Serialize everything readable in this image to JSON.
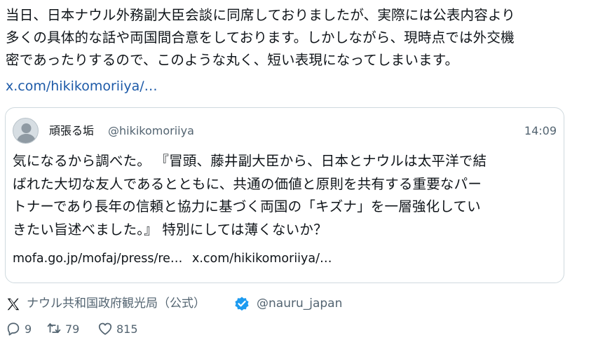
{
  "post": {
    "text_lines": [
      "当日、日本ナウル外務副大臣会談に同席しておりましたが、実際には公表内容より",
      "多くの具体的な話や両国間合意をしております。しかしながら、現時点では外交機",
      "密であったりするので、このような丸く、短い表現になってしまいます。"
    ],
    "link": "x.com/hikikomoriiya/…"
  },
  "quote": {
    "author_name": "頑張る垢",
    "author_handle": "@hikikomoriiya",
    "time": "14:09",
    "text_lines": [
      "気になるから調べた。 『冒頭、藤井副大臣から、日本とナウルは太平洋で結",
      "ばれた大切な友人であるとともに、共通の価値と原則を共有する重要なパー",
      "トナーであり長年の信頼と協力に基づく両国の「キズナ」を一層強化してい",
      "きたい旨述べました。』 特別にしては薄くないか？"
    ],
    "link_1": "mofa.go.jp/mofaj/press/re…",
    "link_2": "x.com/hikikomoriiya/…"
  },
  "author": {
    "name": "ナウル共和国政府観光局（公式）",
    "handle": "@nauru_japan",
    "verified_color": "#1d9bf0",
    "platform_icon": "x-logo-icon"
  },
  "actions": {
    "replies": "9",
    "retweets": "79",
    "likes": "815"
  },
  "colors": {
    "text": "#0f1419",
    "secondary": "#536471",
    "link": "#1d5aa8",
    "border": "#cfd9de"
  }
}
